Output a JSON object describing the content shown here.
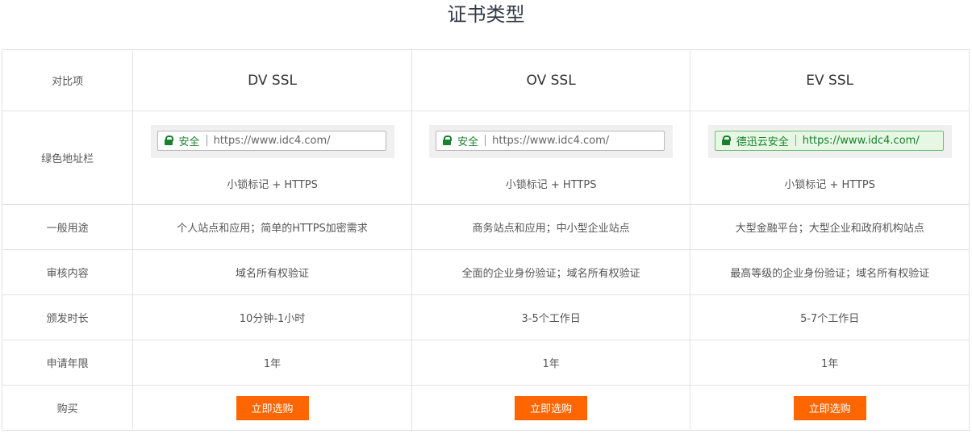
{
  "page_title": "证书类型",
  "columns": {
    "label_header": "对比项",
    "plans": [
      "DV SSL",
      "OV SSL",
      "EV SSL"
    ]
  },
  "address_bar": {
    "row_label": "绿色地址栏",
    "plans": [
      {
        "secure_text": "安全",
        "url": "https://www.idc4.com/",
        "note": "小锁标记 + HTTPS"
      },
      {
        "secure_text": "安全",
        "url": "https://www.idc4.com/",
        "note": "小锁标记 + HTTPS"
      },
      {
        "secure_text": "德迅云安全",
        "url": "https://www.idc4.com/",
        "note": "小锁标记 + HTTPS"
      }
    ],
    "secure_color": "#1a7f2e",
    "ev_background": "#e6f8e4"
  },
  "rows": [
    {
      "label": "一般用途",
      "values": [
        "个人站点和应用；简单的HTTPS加密需求",
        "商务站点和应用；中小型企业站点",
        "大型金融平台；大型企业和政府机构站点"
      ]
    },
    {
      "label": "审核内容",
      "values": [
        "域名所有权验证",
        "全面的企业身份验证；域名所有权验证",
        "最高等级的企业身份验证；域名所有权验证"
      ]
    },
    {
      "label": "颁发时长",
      "values": [
        "10分钟-1小时",
        "3-5个工作日",
        "5-7个工作日"
      ]
    },
    {
      "label": "申请年限",
      "values": [
        "1年",
        "1年",
        "1年"
      ]
    }
  ],
  "buy": {
    "row_label": "购买",
    "button_label": "立即选购",
    "button_color": "#ff6600"
  }
}
